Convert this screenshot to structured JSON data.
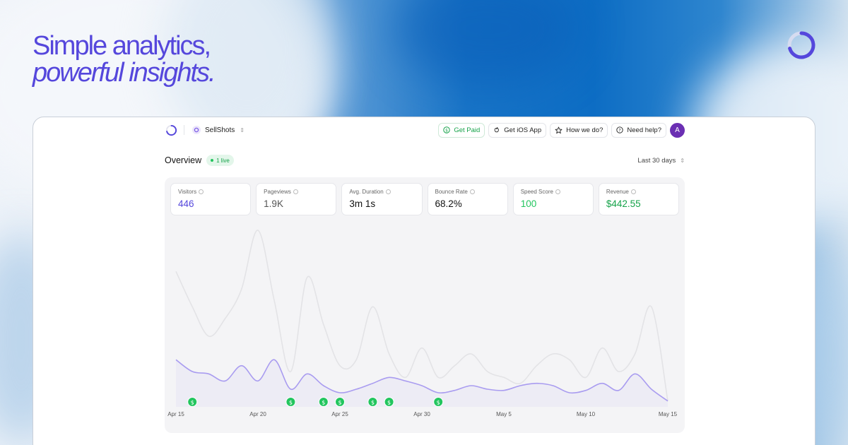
{
  "hero": {
    "headline_line1": "Simple analytics,",
    "headline_line2": "powerful insights."
  },
  "colors": {
    "accent": "#5547dc",
    "visitors_line": "#a99cf0",
    "pageviews_line": "#e3e3e6",
    "revenue_green": "#16a34a",
    "speed_green": "#22c55e",
    "avatar": "#6b2fb3"
  },
  "topbar": {
    "site_name": "SellShots",
    "buttons": [
      {
        "label": "Get Paid",
        "icon": "dollar-icon"
      },
      {
        "label": "Get iOS App",
        "icon": "apple-icon"
      },
      {
        "label": "How we do?",
        "icon": "star-icon"
      },
      {
        "label": "Need help?",
        "icon": "help-icon"
      }
    ],
    "avatar_initial": "A"
  },
  "overview": {
    "title": "Overview",
    "live_badge": "1 live",
    "date_range": "Last 30 days"
  },
  "stats": [
    {
      "label": "Visitors",
      "value": "446",
      "color": "#5547dc"
    },
    {
      "label": "Pageviews",
      "value": "1.9K",
      "color": "#555555"
    },
    {
      "label": "Avg. Duration",
      "value": "3m 1s",
      "color": "#111111"
    },
    {
      "label": "Bounce Rate",
      "value": "68.2%",
      "color": "#111111"
    },
    {
      "label": "Speed Score",
      "value": "100",
      "color": "#22c55e"
    },
    {
      "label": "Revenue",
      "value": "$442.55",
      "color": "#16a34a"
    }
  ],
  "chart_data": {
    "type": "area",
    "x_tick_labels": [
      "Apr 15",
      "Apr 20",
      "Apr 25",
      "Apr 30",
      "May 5",
      "May 10",
      "May 15"
    ],
    "x": [
      "Apr 15",
      "Apr 16",
      "Apr 17",
      "Apr 18",
      "Apr 19",
      "Apr 20",
      "Apr 21",
      "Apr 22",
      "Apr 23",
      "Apr 24",
      "Apr 25",
      "Apr 26",
      "Apr 27",
      "Apr 28",
      "Apr 29",
      "Apr 30",
      "May 1",
      "May 2",
      "May 3",
      "May 4",
      "May 5",
      "May 6",
      "May 7",
      "May 8",
      "May 9",
      "May 10",
      "May 11",
      "May 12",
      "May 13",
      "May 14",
      "May 15"
    ],
    "series": [
      {
        "values": [
          115,
          85,
          60,
          75,
          100,
          150,
          90,
          30,
          110,
          70,
          35,
          40,
          85,
          45,
          25,
          50,
          25,
          35,
          45,
          30,
          25,
          20,
          35,
          45,
          40,
          25,
          50,
          30,
          45,
          85,
          5
        ]
      },
      {
        "values": [
          40,
          30,
          28,
          22,
          35,
          22,
          40,
          15,
          28,
          18,
          12,
          15,
          20,
          25,
          22,
          18,
          12,
          14,
          18,
          15,
          14,
          18,
          20,
          18,
          12,
          14,
          20,
          14,
          28,
          15,
          5
        ]
      }
    ],
    "revenue_markers": [
      "Apr 16",
      "Apr 22",
      "Apr 24",
      "Apr 25",
      "Apr 27",
      "Apr 28",
      "May 1"
    ],
    "grid": false,
    "legend": "none"
  }
}
